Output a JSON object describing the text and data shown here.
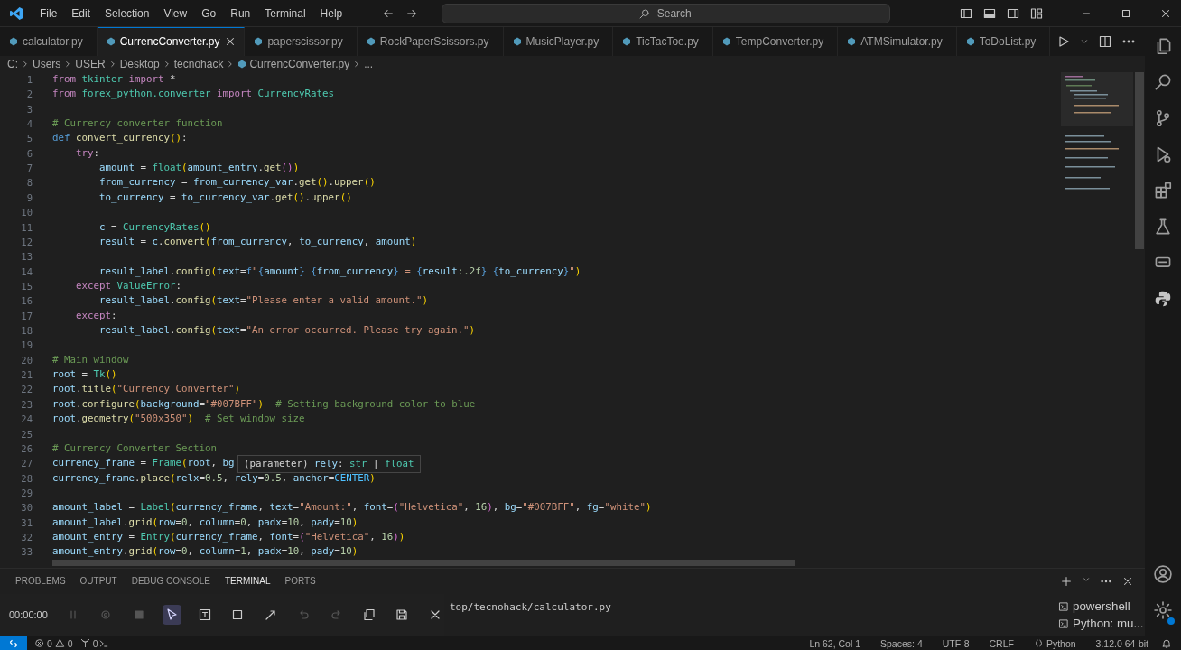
{
  "menu": [
    "File",
    "Edit",
    "Selection",
    "View",
    "Go",
    "Run",
    "Terminal",
    "Help"
  ],
  "search": {
    "placeholder": "Search"
  },
  "tabs": [
    {
      "label": "calculator.py",
      "selected": false
    },
    {
      "label": "CurrencConverter.py",
      "selected": true
    },
    {
      "label": "paperscissor.py",
      "selected": false
    },
    {
      "label": "RockPaperScissors.py",
      "selected": false
    },
    {
      "label": "MusicPlayer.py",
      "selected": false
    },
    {
      "label": "TicTacToe.py",
      "selected": false
    },
    {
      "label": "TempConverter.py",
      "selected": false
    },
    {
      "label": "ATMSimulator.py",
      "selected": false
    },
    {
      "label": "ToDoList.py",
      "selected": false
    }
  ],
  "breadcrumb": [
    {
      "kind": "folder",
      "label": "C:"
    },
    {
      "kind": "folder",
      "label": "Users"
    },
    {
      "kind": "folder",
      "label": "USER"
    },
    {
      "kind": "folder",
      "label": "Desktop"
    },
    {
      "kind": "folder",
      "label": "tecnohack"
    },
    {
      "kind": "file",
      "label": "CurrencConverter.py"
    },
    {
      "kind": "more",
      "label": "..."
    }
  ],
  "lines": [
    {
      "number": "1",
      "tokens": [
        {
          "kind": "k",
          "text": "from"
        },
        {
          "kind": "c",
          "text": " tkinter"
        },
        {
          "kind": "k",
          "text": " import"
        },
        {
          "kind": "p",
          "text": " *"
        }
      ]
    },
    {
      "number": "2",
      "tokens": [
        {
          "kind": "k",
          "text": "from"
        },
        {
          "kind": "c",
          "text": " forex_python.converter"
        },
        {
          "kind": "k",
          "text": " import"
        },
        {
          "kind": "c",
          "text": " CurrencyRates"
        }
      ]
    },
    {
      "number": "3"
    },
    {
      "number": "4",
      "tokens": [
        {
          "kind": "m",
          "text": "# Currency converter function"
        }
      ]
    },
    {
      "number": "5",
      "tokens": [
        {
          "kind": "b",
          "text": "def"
        },
        {
          "kind": "f",
          "text": " convert_currency"
        },
        {
          "kind": "y",
          "text": "()"
        },
        {
          "kind": "p",
          "text": ":"
        }
      ]
    },
    {
      "number": "6",
      "tokens": [
        {
          "kind": "k",
          "text": "    try"
        },
        {
          "kind": "p",
          "text": ":"
        }
      ]
    },
    {
      "number": "7",
      "tokens": [
        {
          "kind": "v",
          "text": "        amount"
        },
        {
          "kind": "p",
          "text": " ="
        },
        {
          "kind": "c",
          "text": " float"
        },
        {
          "kind": "y",
          "text": "("
        },
        {
          "kind": "v",
          "text": "amount_entry"
        },
        {
          "kind": "p",
          "text": "."
        },
        {
          "kind": "f",
          "text": "get"
        },
        {
          "kind": "q",
          "text": "()"
        },
        {
          "kind": "y",
          "text": ")"
        }
      ]
    },
    {
      "number": "8",
      "tokens": [
        {
          "kind": "v",
          "text": "        from_currency"
        },
        {
          "kind": "p",
          "text": " ="
        },
        {
          "kind": "v",
          "text": " from_currency_var"
        },
        {
          "kind": "p",
          "text": "."
        },
        {
          "kind": "f",
          "text": "get"
        },
        {
          "kind": "y",
          "text": "()"
        },
        {
          "kind": "p",
          "text": "."
        },
        {
          "kind": "f",
          "text": "upper"
        },
        {
          "kind": "y",
          "text": "()"
        }
      ]
    },
    {
      "number": "9",
      "tokens": [
        {
          "kind": "v",
          "text": "        to_currency"
        },
        {
          "kind": "p",
          "text": " ="
        },
        {
          "kind": "v",
          "text": " to_currency_var"
        },
        {
          "kind": "p",
          "text": "."
        },
        {
          "kind": "f",
          "text": "get"
        },
        {
          "kind": "y",
          "text": "()"
        },
        {
          "kind": "p",
          "text": "."
        },
        {
          "kind": "f",
          "text": "upper"
        },
        {
          "kind": "y",
          "text": "()"
        }
      ]
    },
    {
      "number": "10"
    },
    {
      "number": "11",
      "tokens": [
        {
          "kind": "v",
          "text": "        c"
        },
        {
          "kind": "p",
          "text": " ="
        },
        {
          "kind": "c",
          "text": " CurrencyRates"
        },
        {
          "kind": "y",
          "text": "()"
        }
      ]
    },
    {
      "number": "12",
      "tokens": [
        {
          "kind": "v",
          "text": "        result"
        },
        {
          "kind": "p",
          "text": " ="
        },
        {
          "kind": "v",
          "text": " c"
        },
        {
          "kind": "p",
          "text": "."
        },
        {
          "kind": "f",
          "text": "convert"
        },
        {
          "kind": "y",
          "text": "("
        },
        {
          "kind": "v",
          "text": "from_currency"
        },
        {
          "kind": "p",
          "text": ","
        },
        {
          "kind": "v",
          "text": " to_currency"
        },
        {
          "kind": "p",
          "text": ","
        },
        {
          "kind": "v",
          "text": " amount"
        },
        {
          "kind": "y",
          "text": ")"
        }
      ]
    },
    {
      "number": "13"
    },
    {
      "number": "14",
      "tokens": [
        {
          "kind": "v",
          "text": "        result_label"
        },
        {
          "kind": "p",
          "text": "."
        },
        {
          "kind": "f",
          "text": "config"
        },
        {
          "kind": "y",
          "text": "("
        },
        {
          "kind": "v",
          "text": "text"
        },
        {
          "kind": "p",
          "text": "="
        },
        {
          "kind": "b",
          "text": "f"
        },
        {
          "kind": "s",
          "text": "\""
        },
        {
          "kind": "b",
          "text": "{"
        },
        {
          "kind": "v",
          "text": "amount"
        },
        {
          "kind": "b",
          "text": "}"
        },
        {
          "kind": "b",
          "text": " {"
        },
        {
          "kind": "v",
          "text": "from_currency"
        },
        {
          "kind": "b",
          "text": "}"
        },
        {
          "kind": "s",
          "text": " ="
        },
        {
          "kind": "b",
          "text": " {"
        },
        {
          "kind": "v",
          "text": "result"
        },
        {
          "kind": "n",
          "text": ":.2f"
        },
        {
          "kind": "b",
          "text": "}"
        },
        {
          "kind": "b",
          "text": " {"
        },
        {
          "kind": "v",
          "text": "to_currency"
        },
        {
          "kind": "b",
          "text": "}"
        },
        {
          "kind": "s",
          "text": "\""
        },
        {
          "kind": "y",
          "text": ")"
        }
      ]
    },
    {
      "number": "15",
      "tokens": [
        {
          "kind": "k",
          "text": "    except"
        },
        {
          "kind": "c",
          "text": " ValueError"
        },
        {
          "kind": "p",
          "text": ":"
        }
      ]
    },
    {
      "number": "16",
      "tokens": [
        {
          "kind": "v",
          "text": "        result_label"
        },
        {
          "kind": "p",
          "text": "."
        },
        {
          "kind": "f",
          "text": "config"
        },
        {
          "kind": "y",
          "text": "("
        },
        {
          "kind": "v",
          "text": "text"
        },
        {
          "kind": "p",
          "text": "="
        },
        {
          "kind": "s",
          "text": "\"Please enter a valid amount.\""
        },
        {
          "kind": "y",
          "text": ")"
        }
      ]
    },
    {
      "number": "17",
      "tokens": [
        {
          "kind": "k",
          "text": "    except"
        },
        {
          "kind": "p",
          "text": ":"
        }
      ]
    },
    {
      "number": "18",
      "tokens": [
        {
          "kind": "v",
          "text": "        result_label"
        },
        {
          "kind": "p",
          "text": "."
        },
        {
          "kind": "f",
          "text": "config"
        },
        {
          "kind": "y",
          "text": "("
        },
        {
          "kind": "v",
          "text": "text"
        },
        {
          "kind": "p",
          "text": "="
        },
        {
          "kind": "s",
          "text": "\"An error occurred. Please try again.\""
        },
        {
          "kind": "y",
          "text": ")"
        }
      ]
    },
    {
      "number": "19"
    },
    {
      "number": "20",
      "tokens": [
        {
          "kind": "m",
          "text": "# Main window"
        }
      ]
    },
    {
      "number": "21",
      "tokens": [
        {
          "kind": "v",
          "text": "root"
        },
        {
          "kind": "p",
          "text": " ="
        },
        {
          "kind": "c",
          "text": " Tk"
        },
        {
          "kind": "y",
          "text": "()"
        }
      ]
    },
    {
      "number": "22",
      "tokens": [
        {
          "kind": "v",
          "text": "root"
        },
        {
          "kind": "p",
          "text": "."
        },
        {
          "kind": "f",
          "text": "title"
        },
        {
          "kind": "y",
          "text": "("
        },
        {
          "kind": "s",
          "text": "\"Currency Converter\""
        },
        {
          "kind": "y",
          "text": ")"
        }
      ]
    },
    {
      "number": "23",
      "tokens": [
        {
          "kind": "v",
          "text": "root"
        },
        {
          "kind": "p",
          "text": "."
        },
        {
          "kind": "f",
          "text": "configure"
        },
        {
          "kind": "y",
          "text": "("
        },
        {
          "kind": "v",
          "text": "background"
        },
        {
          "kind": "p",
          "text": "="
        },
        {
          "kind": "s",
          "text": "\"#007BFF\""
        },
        {
          "kind": "y",
          "text": ")"
        },
        {
          "kind": "m",
          "text": "  # Setting background color to blue"
        }
      ]
    },
    {
      "number": "24",
      "tokens": [
        {
          "kind": "v",
          "text": "root"
        },
        {
          "kind": "p",
          "text": "."
        },
        {
          "kind": "f",
          "text": "geometry"
        },
        {
          "kind": "y",
          "text": "("
        },
        {
          "kind": "s",
          "text": "\"500x350\""
        },
        {
          "kind": "y",
          "text": ")"
        },
        {
          "kind": "m",
          "text": "  # Set window size"
        }
      ]
    },
    {
      "number": "25"
    },
    {
      "number": "26",
      "tokens": [
        {
          "kind": "m",
          "text": "# Currency Converter Section"
        }
      ]
    },
    {
      "number": "27",
      "tokens": [
        {
          "kind": "v",
          "text": "currency_frame"
        },
        {
          "kind": "p",
          "text": " ="
        },
        {
          "kind": "c",
          "text": " Frame"
        },
        {
          "kind": "y",
          "text": "("
        },
        {
          "kind": "v",
          "text": "root"
        },
        {
          "kind": "p",
          "text": ","
        },
        {
          "kind": "v",
          "text": " bg"
        }
      ],
      "hover": [
        {
          "kind": "p",
          "text": "(parameter)"
        },
        {
          "kind": "v",
          "text": " rely"
        },
        {
          "kind": "p",
          "text": ":"
        },
        {
          "kind": "c",
          "text": " str"
        },
        {
          "kind": "p",
          "text": " |"
        },
        {
          "kind": "c",
          "text": " float"
        }
      ]
    },
    {
      "number": "28",
      "tokens": [
        {
          "kind": "v",
          "text": "currency_frame"
        },
        {
          "kind": "p",
          "text": "."
        },
        {
          "kind": "f",
          "text": "place"
        },
        {
          "kind": "y",
          "text": "("
        },
        {
          "kind": "v",
          "text": "relx"
        },
        {
          "kind": "p",
          "text": "="
        },
        {
          "kind": "n",
          "text": "0.5"
        },
        {
          "kind": "p",
          "text": ","
        },
        {
          "kind": "v",
          "text": " rely"
        },
        {
          "kind": "p",
          "text": "="
        },
        {
          "kind": "n",
          "text": "0.5"
        },
        {
          "kind": "p",
          "text": ","
        },
        {
          "kind": "v",
          "text": " anchor"
        },
        {
          "kind": "p",
          "text": "="
        },
        {
          "kind": "o",
          "text": "CENTER"
        },
        {
          "kind": "y",
          "text": ")"
        }
      ]
    },
    {
      "number": "29"
    },
    {
      "number": "30",
      "tokens": [
        {
          "kind": "v",
          "text": "amount_label"
        },
        {
          "kind": "p",
          "text": " ="
        },
        {
          "kind": "c",
          "text": " Label"
        },
        {
          "kind": "y",
          "text": "("
        },
        {
          "kind": "v",
          "text": "currency_frame"
        },
        {
          "kind": "p",
          "text": ","
        },
        {
          "kind": "v",
          "text": " text"
        },
        {
          "kind": "p",
          "text": "="
        },
        {
          "kind": "s",
          "text": "\"Amount:\""
        },
        {
          "kind": "p",
          "text": ","
        },
        {
          "kind": "v",
          "text": " font"
        },
        {
          "kind": "p",
          "text": "="
        },
        {
          "kind": "q",
          "text": "("
        },
        {
          "kind": "s",
          "text": "\"Helvetica\""
        },
        {
          "kind": "p",
          "text": ","
        },
        {
          "kind": "n",
          "text": " 16"
        },
        {
          "kind": "q",
          "text": ")"
        },
        {
          "kind": "p",
          "text": ","
        },
        {
          "kind": "v",
          "text": " bg"
        },
        {
          "kind": "p",
          "text": "="
        },
        {
          "kind": "s",
          "text": "\"#007BFF\""
        },
        {
          "kind": "p",
          "text": ","
        },
        {
          "kind": "v",
          "text": " fg"
        },
        {
          "kind": "p",
          "text": "="
        },
        {
          "kind": "s",
          "text": "\"white\""
        },
        {
          "kind": "y",
          "text": ")"
        }
      ]
    },
    {
      "number": "31",
      "tokens": [
        {
          "kind": "v",
          "text": "amount_label"
        },
        {
          "kind": "p",
          "text": "."
        },
        {
          "kind": "f",
          "text": "grid"
        },
        {
          "kind": "y",
          "text": "("
        },
        {
          "kind": "v",
          "text": "row"
        },
        {
          "kind": "p",
          "text": "="
        },
        {
          "kind": "n",
          "text": "0"
        },
        {
          "kind": "p",
          "text": ","
        },
        {
          "kind": "v",
          "text": " column"
        },
        {
          "kind": "p",
          "text": "="
        },
        {
          "kind": "n",
          "text": "0"
        },
        {
          "kind": "p",
          "text": ","
        },
        {
          "kind": "v",
          "text": " padx"
        },
        {
          "kind": "p",
          "text": "="
        },
        {
          "kind": "n",
          "text": "10"
        },
        {
          "kind": "p",
          "text": ","
        },
        {
          "kind": "v",
          "text": " pady"
        },
        {
          "kind": "p",
          "text": "="
        },
        {
          "kind": "n",
          "text": "10"
        },
        {
          "kind": "y",
          "text": ")"
        }
      ]
    },
    {
      "number": "32",
      "tokens": [
        {
          "kind": "v",
          "text": "amount_entry"
        },
        {
          "kind": "p",
          "text": " ="
        },
        {
          "kind": "c",
          "text": " Entry"
        },
        {
          "kind": "y",
          "text": "("
        },
        {
          "kind": "v",
          "text": "currency_frame"
        },
        {
          "kind": "p",
          "text": ","
        },
        {
          "kind": "v",
          "text": " font"
        },
        {
          "kind": "p",
          "text": "="
        },
        {
          "kind": "q",
          "text": "("
        },
        {
          "kind": "s",
          "text": "\"Helvetica\""
        },
        {
          "kind": "p",
          "text": ","
        },
        {
          "kind": "n",
          "text": " 16"
        },
        {
          "kind": "q",
          "text": ")"
        },
        {
          "kind": "y",
          "text": ")"
        }
      ]
    },
    {
      "number": "33",
      "tokens": [
        {
          "kind": "v",
          "text": "amount_entry"
        },
        {
          "kind": "p",
          "text": "."
        },
        {
          "kind": "f",
          "text": "grid"
        },
        {
          "kind": "y",
          "text": "("
        },
        {
          "kind": "v",
          "text": "row"
        },
        {
          "kind": "p",
          "text": "="
        },
        {
          "kind": "n",
          "text": "0"
        },
        {
          "kind": "p",
          "text": ","
        },
        {
          "kind": "v",
          "text": " column"
        },
        {
          "kind": "p",
          "text": "="
        },
        {
          "kind": "n",
          "text": "1"
        },
        {
          "kind": "p",
          "text": ","
        },
        {
          "kind": "v",
          "text": " padx"
        },
        {
          "kind": "p",
          "text": "="
        },
        {
          "kind": "n",
          "text": "10"
        },
        {
          "kind": "p",
          "text": ","
        },
        {
          "kind": "v",
          "text": " pady"
        },
        {
          "kind": "p",
          "text": "="
        },
        {
          "kind": "n",
          "text": "10"
        },
        {
          "kind": "y",
          "text": ")"
        }
      ]
    }
  ],
  "panel_tabs": [
    {
      "label": "PROBLEMS",
      "selected": false
    },
    {
      "label": "OUTPUT",
      "selected": false
    },
    {
      "label": "DEBUG CONSOLE",
      "selected": false
    },
    {
      "label": "TERMINAL",
      "selected": true
    },
    {
      "label": "PORTS",
      "selected": false
    }
  ],
  "recorder": {
    "time": "00:00:00",
    "tools": [
      {
        "kind": "pause",
        "selected": false,
        "disabled": true
      },
      {
        "kind": "camera",
        "selected": false,
        "disabled": true
      },
      {
        "kind": "stop",
        "selected": false,
        "disabled": true
      },
      {
        "kind": "pointer",
        "selected": true,
        "disabled": false
      },
      {
        "kind": "text",
        "selected": false,
        "disabled": false
      },
      {
        "kind": "rectangle",
        "selected": false,
        "disabled": false
      },
      {
        "kind": "arrow",
        "selected": false,
        "disabled": false
      },
      {
        "kind": "undo",
        "selected": false,
        "disabled": true
      },
      {
        "kind": "redo",
        "selected": false,
        "disabled": true
      },
      {
        "kind": "copy",
        "selected": false,
        "disabled": false
      },
      {
        "kind": "save",
        "selected": false,
        "disabled": false
      },
      {
        "kind": "close",
        "selected": false,
        "disabled": false
      }
    ]
  },
  "terminal": {
    "output": "top/tecnohack/calculator.py"
  },
  "terminals": [
    {
      "label": "powershell"
    },
    {
      "label": "Python: mu..."
    }
  ],
  "status_bar": {
    "errors": "0",
    "warnings": "0",
    "ports": "0",
    "right": [
      "Ln 62, Col 1",
      "Spaces: 4",
      "UTF-8",
      "CRLF",
      "Python",
      "3.12.0 64-bit"
    ]
  }
}
